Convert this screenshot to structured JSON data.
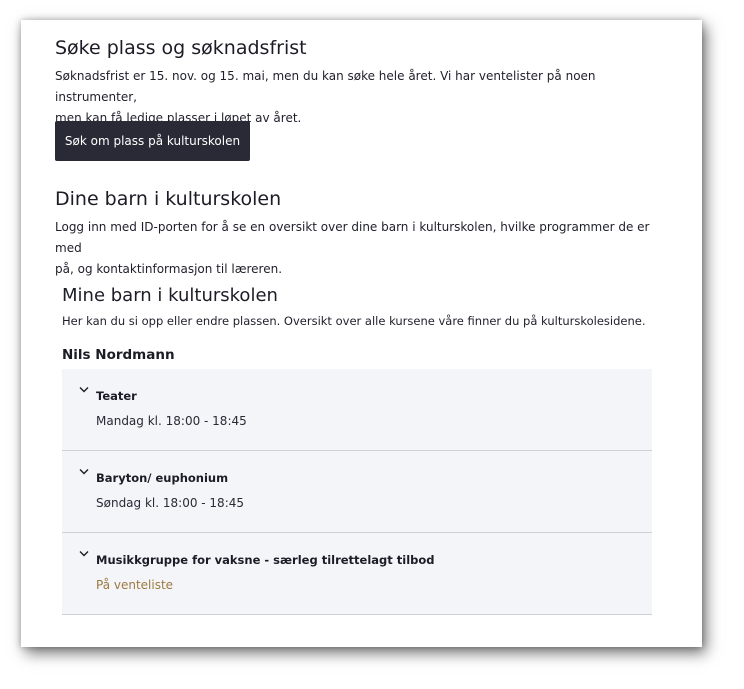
{
  "apply": {
    "heading": "Søke plass og søknadsfrist",
    "text_line1": "Søknadsfrist er 15. nov. og 15. mai, men du kan søke hele året. Vi har ventelister på noen instrumenter,",
    "text_line2": "men kan få ledige plasser i løpet av året.",
    "button_label": "Søk om plass på kulturskolen"
  },
  "children_section": {
    "heading": "Dine barn i kulturskolen",
    "text_line1": "Logg inn med ID-porten for å se en oversikt over dine barn i kulturskolen, hvilke programmer de er med",
    "text_line2": "på, og kontaktinformasjon til læreren."
  },
  "my_children": {
    "heading": "Mine barn i kulturskolen",
    "text": "Her kan du si opp eller endre plassen. Oversikt over alle kursene våre finner du på kulturskolesidene.",
    "child_name": "Nils Nordmann",
    "courses": [
      {
        "title": "Teater",
        "subtitle": "Mandag kl. 18:00 - 18:45",
        "status": "scheduled"
      },
      {
        "title": "Baryton/ euphonium",
        "subtitle": "Søndag kl. 18:00 - 18:45",
        "status": "scheduled"
      },
      {
        "title": "Musikkgruppe for vaksne - særleg tilrettelagt tilbod",
        "subtitle": "På venteliste",
        "status": "waitlist"
      }
    ]
  },
  "colors": {
    "button_bg": "#2a2936",
    "accordion_bg": "#f4f5f9",
    "waitlist_text": "#9c7a3f"
  },
  "icons": {
    "accordion_toggle": "chevron-down-icon"
  }
}
